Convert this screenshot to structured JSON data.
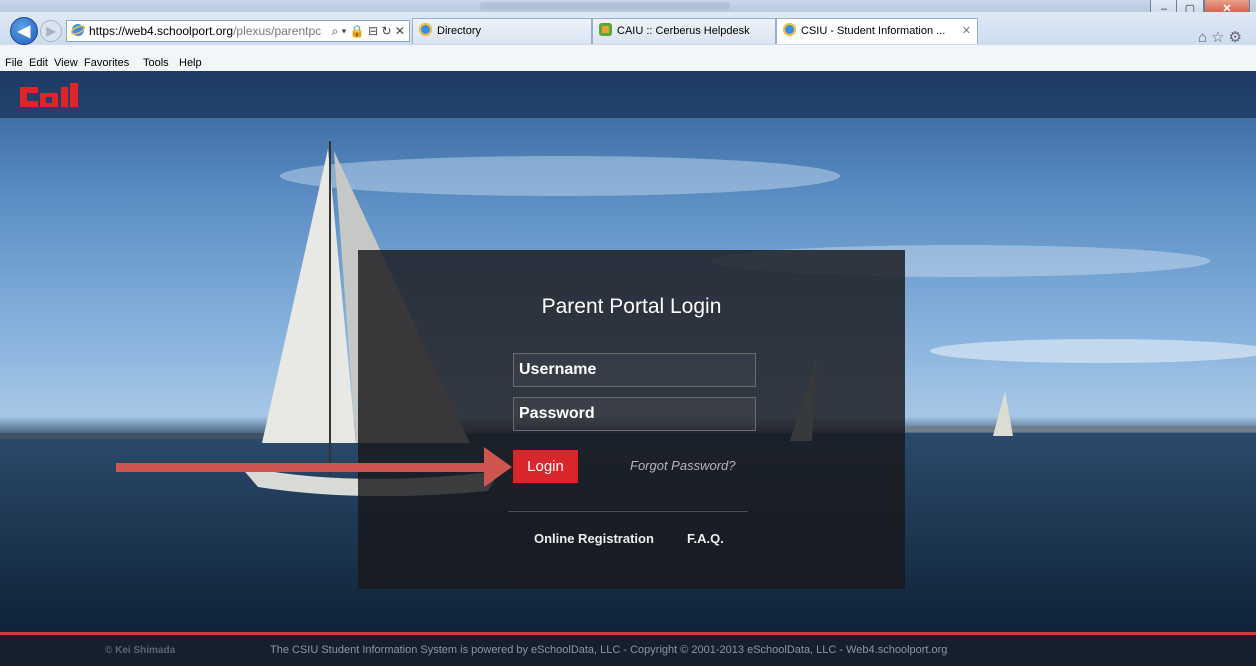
{
  "browser": {
    "url_host": "https://web4.schoolport.org",
    "url_path": "/plexus/parentpc",
    "addr_tools": "⌕ ▾ 🔒 ⊟ ↻ ✕",
    "tabs": [
      {
        "label": "Directory"
      },
      {
        "label": "CAIU :: Cerberus Helpdesk"
      },
      {
        "label": "CSIU - Student Information ...",
        "close": "✕"
      }
    ],
    "window_controls": {
      "minimize": "–",
      "maximize": "▢",
      "close": "✕"
    },
    "right_icons": "⌂☆⚙"
  },
  "menu": [
    "File",
    "Edit",
    "View",
    "Favorites",
    "Tools",
    "Help"
  ],
  "page": {
    "logo_alt": "CSIU",
    "login": {
      "title": "Parent Portal Login",
      "username_placeholder": "Username",
      "password_placeholder": "Password",
      "login_label": "Login",
      "forgot_label": "Forgot Password?",
      "online_registration": "Online Registration",
      "faq": "F.A.Q."
    },
    "footer": {
      "credit": "© Kei Shimada",
      "text": "The CSIU Student Information System is powered by eSchoolData, LLC - Copyright © 2001-2013 eSchoolData, LLC - Web4.schoolport.org"
    }
  },
  "colors": {
    "accent": "#d9262b",
    "arrow": "#d0554e"
  }
}
